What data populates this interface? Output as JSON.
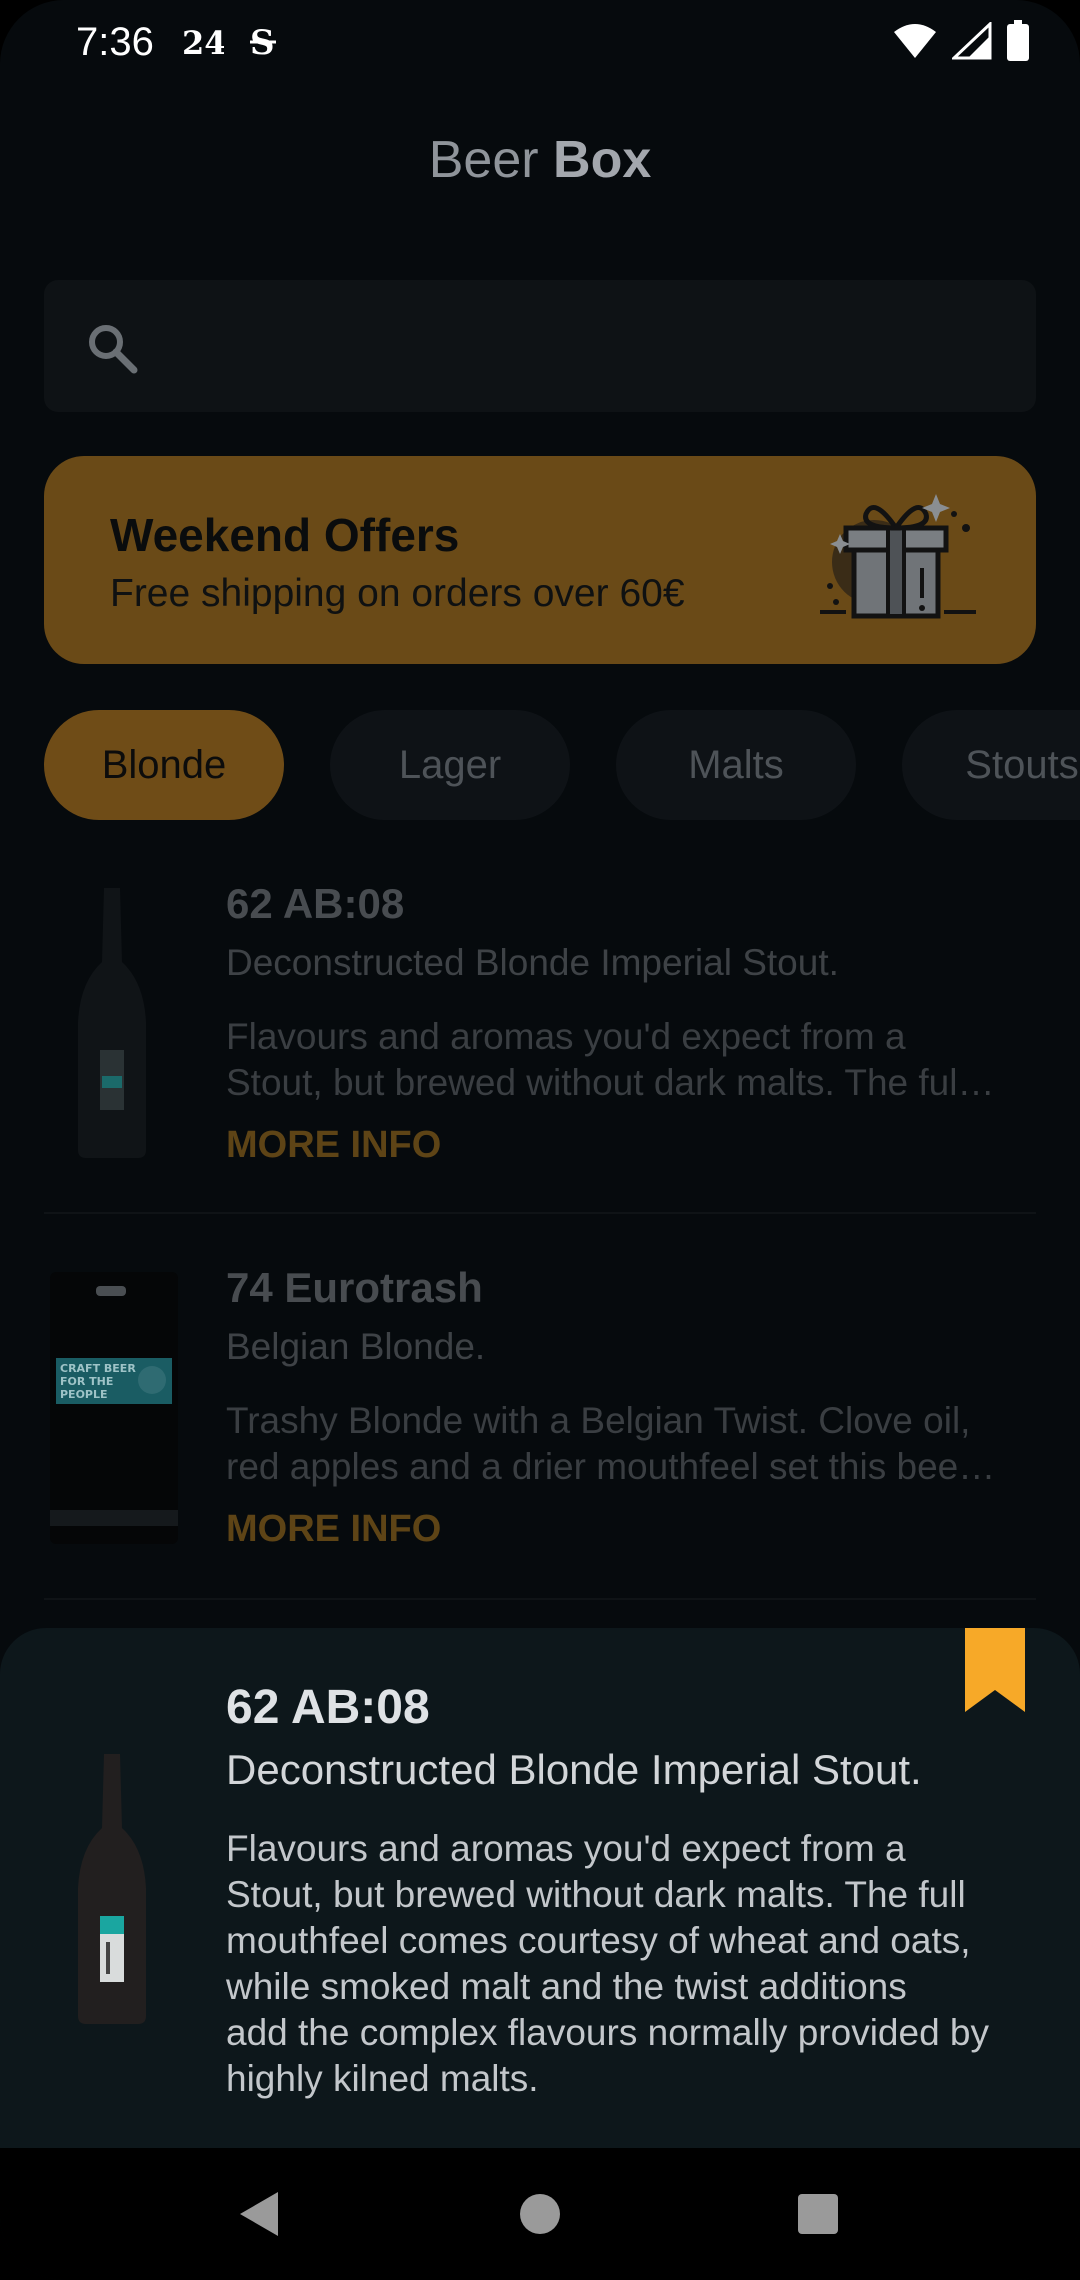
{
  "status_bar": {
    "time": "7:36",
    "icons": [
      "calendar-24-icon",
      "s-app-icon"
    ],
    "right_icons": [
      "wifi-icon",
      "signal-icon",
      "battery-icon"
    ]
  },
  "header": {
    "title_light": "Beer",
    "title_bold": "Box"
  },
  "search": {
    "placeholder": "",
    "value": ""
  },
  "banner": {
    "title": "Weekend Offers",
    "subtitle": "Free shipping on orders over 60€",
    "icon": "gift-icon"
  },
  "chips": [
    {
      "label": "Blonde",
      "active": true
    },
    {
      "label": "Lager",
      "active": false
    },
    {
      "label": "Malts",
      "active": false
    },
    {
      "label": "Stouts",
      "active": false
    }
  ],
  "list": [
    {
      "name": "62 AB:08",
      "tagline": "Deconstructed Blonde Imperial Stout.",
      "desc_line1": "Flavours and aromas you'd expect from a",
      "desc_line2": "Stout, but brewed without dark malts. The ful…",
      "more": "MORE INFO",
      "thumb": "bottle"
    },
    {
      "name": "74 Eurotrash",
      "tagline": "Belgian Blonde.",
      "desc_line1": "Trashy Blonde with a Belgian Twist. Clove oil,",
      "desc_line2": "red apples and a drier mouthfeel set this bee…",
      "more": "MORE INFO",
      "thumb": "keg",
      "keg_text_1": "CRAFT BEER",
      "keg_text_2": "FOR THE",
      "keg_text_3": "PEOPLE"
    }
  ],
  "detail": {
    "name": "62 AB:08",
    "tagline": "Deconstructed Blonde Imperial Stout.",
    "description_lines": [
      "Flavours and aromas you'd expect from a",
      "Stout, but brewed without dark malts. The full",
      "mouthfeel comes courtesy of wheat and oats,",
      "while smoked malt and the twist additions",
      "add the complex flavours normally provided by",
      "highly kilned malts."
    ],
    "bookmark_color": "#f7a928"
  },
  "colors": {
    "background": "#060a0d",
    "accent": "#6f4c17",
    "bookmark": "#f7a928",
    "sheet": "#0d171b"
  },
  "nav": [
    "back-icon",
    "home-icon",
    "recents-icon"
  ]
}
